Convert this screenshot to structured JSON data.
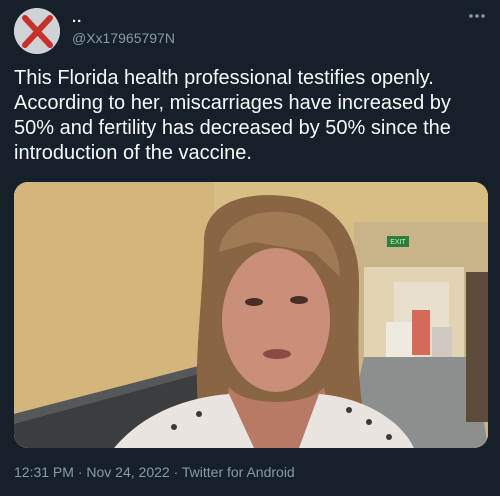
{
  "user": {
    "display_name": "..",
    "handle": "@Xx17965797N",
    "avatar_icon": "red-x-icon"
  },
  "more_icon": "more-horizontal-icon",
  "tweet": {
    "text": "This Florida health professional testifies openly. According to her, miscarriages have increased by 50% and fertility has decreased by 50% since the introduction of the vaccine."
  },
  "media": {
    "type": "video",
    "sign_text": "EXIT"
  },
  "meta": {
    "time": "12:31 PM",
    "separator1": " · ",
    "date": "Nov 24, 2022",
    "separator2": " · ",
    "source": "Twitter for Android"
  },
  "colors": {
    "background": "#15202b",
    "text_primary": "#f7f9f9",
    "text_secondary": "#8b98a5",
    "avatar_x": "#c8302c"
  }
}
